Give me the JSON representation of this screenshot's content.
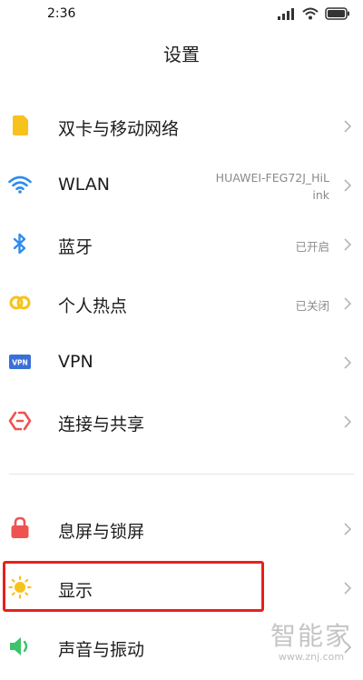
{
  "status_bar": {
    "time": "2:36"
  },
  "page": {
    "title": "设置"
  },
  "items": [
    {
      "label": "双卡与移动网络",
      "value": "",
      "icon": "sim-card-icon"
    },
    {
      "label": "WLAN",
      "value_line1": "HUAWEI-FEG72J_HiL",
      "value_line2": "ink",
      "icon": "wifi-icon"
    },
    {
      "label": "蓝牙",
      "value": "已开启",
      "icon": "bluetooth-icon"
    },
    {
      "label": "个人热点",
      "value": "已关闭",
      "icon": "hotspot-icon"
    },
    {
      "label": "VPN",
      "value": "",
      "icon": "vpn-icon",
      "icon_text": "VPN"
    },
    {
      "label": "连接与共享",
      "value": "",
      "icon": "share-icon"
    },
    {
      "label": "息屏与锁屏",
      "value": "",
      "icon": "lock-icon"
    },
    {
      "label": "显示",
      "value": "",
      "icon": "sun-icon"
    },
    {
      "label": "声音与振动",
      "value": "",
      "icon": "speaker-icon"
    }
  ],
  "watermark": {
    "main": "智能家",
    "sub": "www.znj.com"
  },
  "colors": {
    "highlight": "#e8201b",
    "accent_blue": "#2d8cf0",
    "yellow": "#f7c21b",
    "red": "#ef5350",
    "green": "#3cc46a"
  }
}
